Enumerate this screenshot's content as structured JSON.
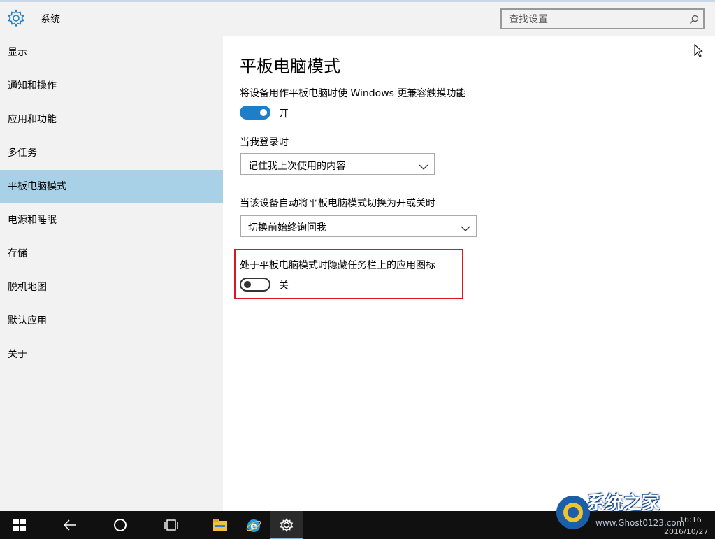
{
  "header": {
    "app_title": "系统",
    "search": {
      "placeholder": "查找设置",
      "value": ""
    }
  },
  "sidebar": {
    "items": [
      {
        "label": "显示",
        "active": false
      },
      {
        "label": "通知和操作",
        "active": false
      },
      {
        "label": "应用和功能",
        "active": false
      },
      {
        "label": "多任务",
        "active": false
      },
      {
        "label": "平板电脑模式",
        "active": true
      },
      {
        "label": "电源和睡眠",
        "active": false
      },
      {
        "label": "存储",
        "active": false
      },
      {
        "label": "脱机地图",
        "active": false
      },
      {
        "label": "默认应用",
        "active": false
      },
      {
        "label": "关于",
        "active": false
      }
    ]
  },
  "main": {
    "title": "平板电脑模式",
    "touch_setting": {
      "label": "将设备用作平板电脑时使 Windows 更兼容触摸功能",
      "state": "开",
      "on": true
    },
    "login_setting": {
      "label": "当我登录时",
      "value": "记住我上次使用的内容"
    },
    "switch_setting": {
      "label": "当该设备自动将平板电脑模式切换为开或关时",
      "value": "切换前始终询问我"
    },
    "hide_icons_setting": {
      "label": "处于平板电脑模式时隐藏任务栏上的应用图标",
      "state": "关",
      "on": false
    }
  },
  "taskbar": {
    "time": "16:16",
    "date": "2016/10/27",
    "watermark_text": "系统之家",
    "watermark_url": "www.Ghost0123.com"
  },
  "colors": {
    "accent": "#1e7ec8",
    "active_nav": "#a8d0e6",
    "highlight_border": "#e0141c",
    "sidebar_bg": "#f2f2f2"
  }
}
